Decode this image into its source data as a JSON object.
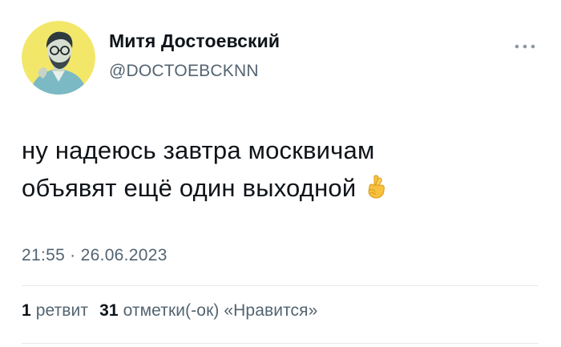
{
  "author": {
    "name": "Митя Достоевский",
    "handle": "@DOCTOEBCKNN"
  },
  "tweet": {
    "line1": "ну надеюсь завтра москвичам",
    "line2": "объявят ещё один выходной",
    "emoji": "crossed-fingers"
  },
  "timestamp": "21:55 · 26.06.2023",
  "stats": {
    "retweets": {
      "count": "1",
      "label": "ретвит"
    },
    "likes": {
      "count": "31",
      "label": "отметки(-ок) «Нравится»"
    }
  },
  "colors": {
    "avatar_bg": "#f3e76a",
    "secondary_text": "#536471",
    "primary_text": "#0f1419",
    "divider": "#e7e9ea"
  }
}
